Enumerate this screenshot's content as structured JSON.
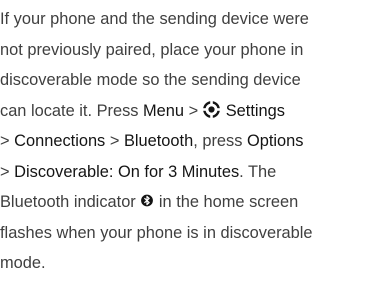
{
  "lines": [
    {
      "text": "If your phone and the sending device were"
    },
    {
      "text": "not previously paired, place your phone in"
    },
    {
      "text": "discoverable mode so the sending device"
    },
    {
      "pre": "can locate it. Press ",
      "key1": "Menu",
      "sep": " > ",
      "key2": "Settings"
    },
    {
      "pre": "> ",
      "key1": "Connections",
      "sep": " > ",
      "key2": "Bluetooth",
      "mid": ", press ",
      "key3": "Options"
    },
    {
      "pre": "> ",
      "key1": "Discoverable: On for 3 Minutes",
      "post": ". The"
    },
    {
      "pre": "Bluetooth indicator ",
      "post": " in the home screen"
    },
    {
      "text": "flashes when your phone is in discoverable"
    },
    {
      "text": "mode."
    }
  ],
  "icons": {
    "settings": "gear-icon",
    "bluetooth": "bluetooth-icon"
  },
  "colors": {
    "text": "#3f3f3f",
    "key_text": "#141414"
  }
}
